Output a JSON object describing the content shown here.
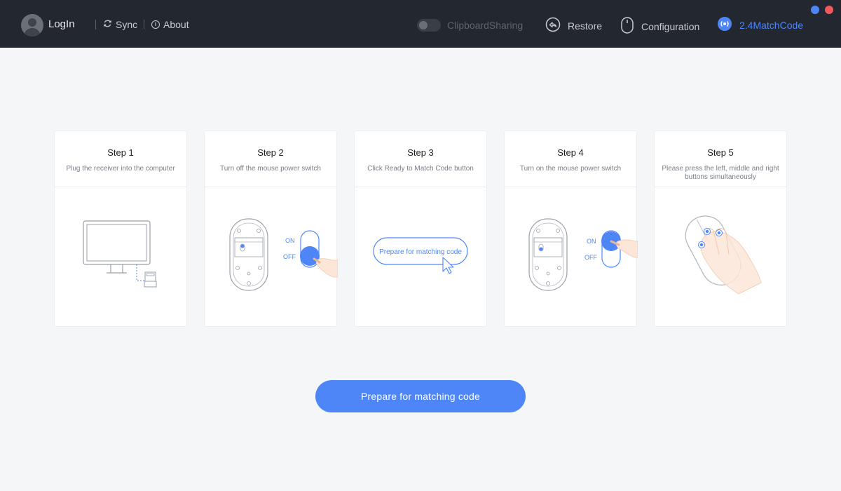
{
  "header": {
    "login_label": "LogIn",
    "sync_label": "Sync",
    "about_label": "About",
    "clipboard_label": "ClipboardSharing",
    "clipboard_on": false,
    "restore_label": "Restore",
    "configuration_label": "Configuration",
    "match_label": "2.4MatchCode"
  },
  "colors": {
    "accent": "#4e86f7",
    "topbar": "#232730",
    "close": "#f25a5a",
    "background": "#f5f6f8"
  },
  "steps": [
    {
      "title": "Step 1",
      "desc": "Plug the receiver into the computer"
    },
    {
      "title": "Step 2",
      "desc": "Turn off the mouse power switch",
      "on": "ON",
      "off": "OFF"
    },
    {
      "title": "Step 3",
      "desc": "Click Ready to Match Code button",
      "button": "Prepare for matching code"
    },
    {
      "title": "Step 4",
      "desc": "Turn on the mouse power switch",
      "on": "ON",
      "off": "OFF"
    },
    {
      "title": "Step 5",
      "desc": "Please press the left, middle and right buttons simultaneously"
    }
  ],
  "main_button": "Prepare for matching code"
}
